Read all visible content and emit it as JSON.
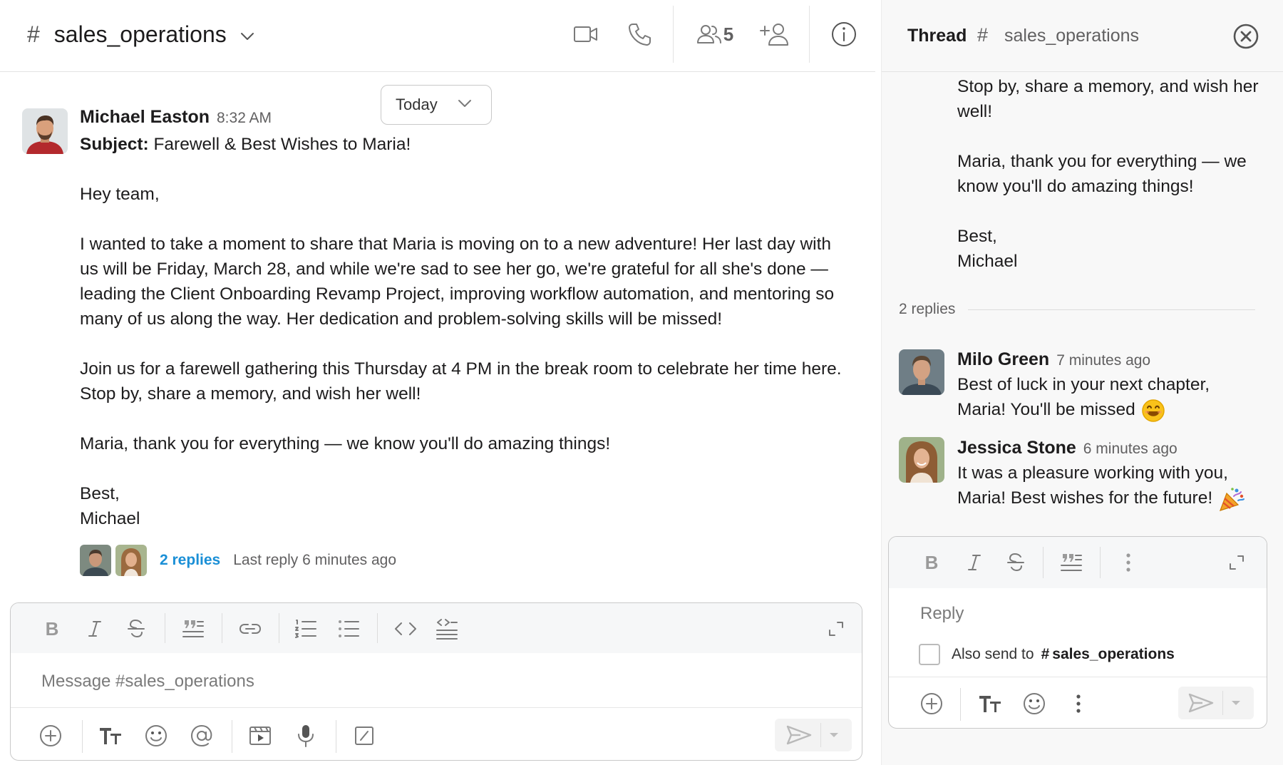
{
  "channel": {
    "hash": "#",
    "name": "sales_operations",
    "member_count": "5"
  },
  "date_filter": {
    "label": "Today"
  },
  "message": {
    "author": "Michael Easton",
    "time": "8:32 AM",
    "subject_label": "Subject:",
    "subject": "Farewell & Best Wishes to Maria!",
    "greeting": "Hey team,",
    "para1": "I wanted to take a moment to share that Maria is moving on to a new adventure! Her last day with us will be Friday, March 28, and while we're sad to see her go, we're grateful for all she's done — leading the Client Onboarding Revamp Project, improving workflow automation, and mentoring so many of us along the way. Her dedication and problem-solving skills will be missed!",
    "para2": "Join us for a farewell gathering this Thursday at 4 PM in the break room to celebrate her time here. Stop by, share a memory, and wish her well!",
    "para3": "Maria, thank you for everything — we know you'll do amazing things!",
    "signoff": "Best,",
    "signature": "Michael",
    "replies_link": "2 replies",
    "last_reply": "Last reply 6 minutes ago"
  },
  "composer": {
    "placeholder": "Message #sales_operations"
  },
  "thread": {
    "title": "Thread",
    "hash": "#",
    "channel": "sales_operations",
    "body_line1": "Stop by, share a memory, and wish her well!",
    "body_line2": "Maria, thank you for everything — we know you'll do amazing things!",
    "body_signoff": "Best,",
    "body_signature": "Michael",
    "reply_count": "2 replies",
    "replies": [
      {
        "author": "Milo Green",
        "time": "7 minutes ago",
        "text": "Best of luck in your next chapter, Maria! You'll be missed"
      },
      {
        "author": "Jessica Stone",
        "time": "6 minutes ago",
        "text": "It was a pleasure working with you, Maria! Best wishes for the future!"
      }
    ],
    "composer": {
      "placeholder": "Reply",
      "also_send_label": "Also send to",
      "also_send_hash": "#",
      "also_send_channel": "sales_operations"
    }
  },
  "icons": [
    "hash-icon",
    "chevron-down-icon",
    "video-icon",
    "phone-icon",
    "members-icon",
    "add-member-icon",
    "info-icon",
    "close-icon",
    "bold-icon",
    "italic-icon",
    "strikethrough-icon",
    "quote-icon",
    "link-icon",
    "ordered-list-icon",
    "bulleted-list-icon",
    "code-icon",
    "code-block-icon",
    "expand-icon",
    "plus-icon",
    "text-format-icon",
    "emoji-icon",
    "mention-icon",
    "video-clip-icon",
    "microphone-icon",
    "slash-command-icon",
    "send-icon",
    "more-icon",
    "smile-emoji-icon",
    "party-popper-icon"
  ],
  "colors": {
    "link": "#1a8fd6",
    "text": "#1d1c1d",
    "muted": "#616061",
    "panel_bg": "#f8f8f8"
  }
}
